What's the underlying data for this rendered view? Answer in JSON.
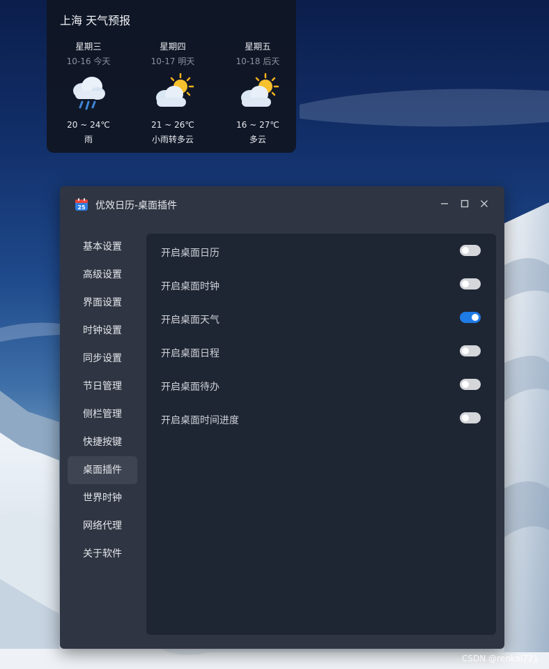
{
  "weather": {
    "title": "上海 天气预报",
    "days": [
      {
        "name": "星期三",
        "date": "10-16 今天",
        "temp": "20 ~ 24℃",
        "condition": "雨",
        "icon": "rain-cloud-icon"
      },
      {
        "name": "星期四",
        "date": "10-17 明天",
        "temp": "21 ~ 26℃",
        "condition": "小雨转多云",
        "icon": "partly-cloudy-icon"
      },
      {
        "name": "星期五",
        "date": "10-18 后天",
        "temp": "16 ~ 27℃",
        "condition": "多云",
        "icon": "partly-cloudy-icon"
      }
    ]
  },
  "window": {
    "app_icon_number": "25",
    "title": "优效日历-桌面插件",
    "controls": [
      "minimize-icon",
      "maximize-icon",
      "close-icon"
    ]
  },
  "sidebar": {
    "items": [
      {
        "label": "基本设置",
        "active": false
      },
      {
        "label": "高级设置",
        "active": false
      },
      {
        "label": "界面设置",
        "active": false
      },
      {
        "label": "时钟设置",
        "active": false
      },
      {
        "label": "同步设置",
        "active": false
      },
      {
        "label": "节日管理",
        "active": false
      },
      {
        "label": "侧栏管理",
        "active": false
      },
      {
        "label": "快捷按键",
        "active": false
      },
      {
        "label": "桌面插件",
        "active": true
      },
      {
        "label": "世界时钟",
        "active": false
      },
      {
        "label": "网络代理",
        "active": false
      },
      {
        "label": "关于软件",
        "active": false
      }
    ]
  },
  "settings": {
    "rows": [
      {
        "label": "开启桌面日历",
        "enabled": false
      },
      {
        "label": "开启桌面时钟",
        "enabled": false
      },
      {
        "label": "开启桌面天气",
        "enabled": true
      },
      {
        "label": "开启桌面日程",
        "enabled": false
      },
      {
        "label": "开启桌面待办",
        "enabled": false
      },
      {
        "label": "开启桌面时间进度",
        "enabled": false
      }
    ]
  },
  "colors": {
    "accent": "#1f7be6",
    "window_bg": "#2f3542",
    "panel_bg": "#1f2633",
    "active_nav_bg": "#3e4452"
  },
  "watermark": "CSDN @renkai721"
}
